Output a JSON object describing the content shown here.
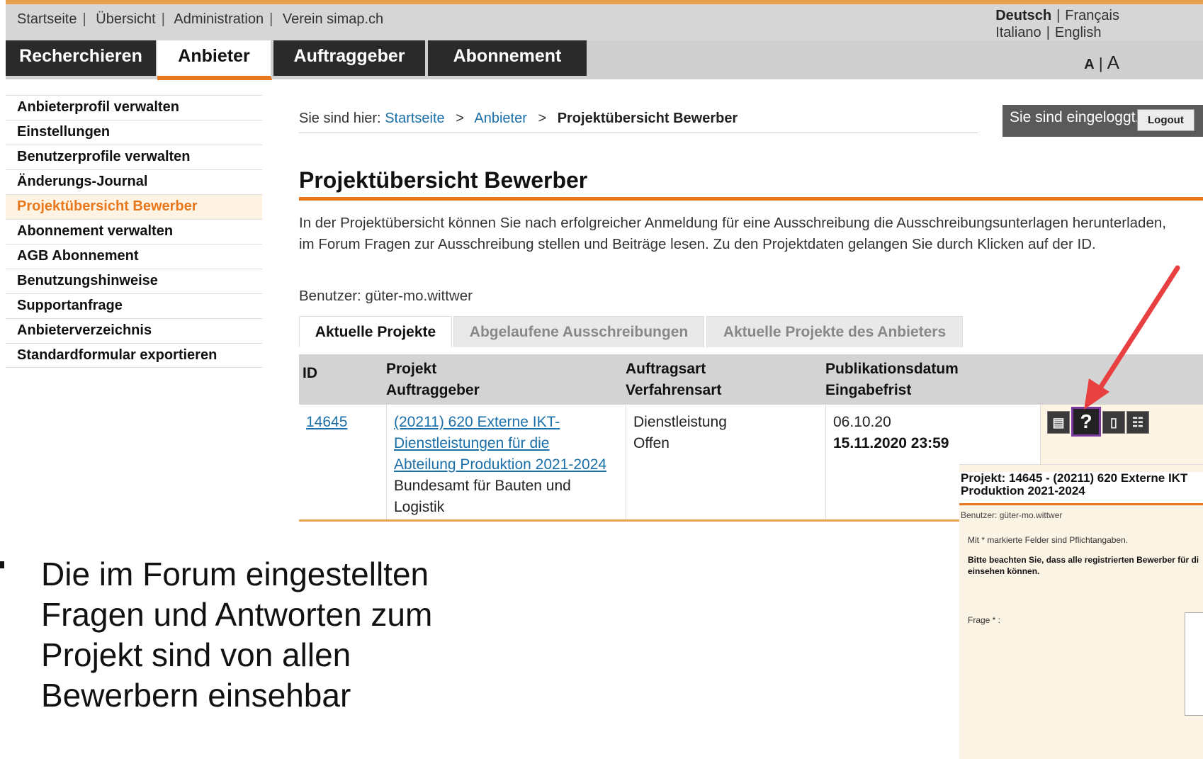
{
  "top_links": [
    "Startseite",
    "Übersicht",
    "Administration",
    "Verein simap.ch"
  ],
  "languages": {
    "line1_active": "Deutsch",
    "line1_other": "Français",
    "line2_a": "Italiano",
    "line2_b": "English"
  },
  "nav": {
    "tabs": [
      "Recherchieren",
      "Anbieter",
      "Auftraggeber",
      "Abonnement"
    ],
    "active": "Anbieter"
  },
  "font_size": {
    "small": "A",
    "sep": "|",
    "big": "A"
  },
  "sidebar": {
    "items": [
      "Anbieterprofil verwalten",
      "Einstellungen",
      "Benutzerprofile verwalten",
      "Änderungs-Journal",
      "Projektübersicht Bewerber",
      "Abonnement verwalten",
      "AGB Abonnement",
      "Benutzungshinweise",
      "Supportanfrage",
      "Anbieterverzeichnis",
      "Standardformular exportieren"
    ],
    "active": "Projektübersicht Bewerber"
  },
  "breadcrumb": {
    "prefix": "Sie sind hier:",
    "items": [
      "Startseite",
      "Anbieter"
    ],
    "current": "Projektübersicht Bewerber",
    "sep": ">"
  },
  "login": {
    "status": "Sie sind eingeloggt.",
    "logout": "Logout"
  },
  "page": {
    "title": "Projektübersicht Bewerber",
    "intro": "In der Projektübersicht können Sie nach erfolgreicher Anmeldung für eine Ausschreibung die Ausschreibungsunterlagen herunterladen, im Forum Fragen zur Ausschreibung stellen und Beiträge lesen. Zu den Projektdaten gelangen Sie durch Klicken auf der ID.",
    "user": "Benutzer: güter-mo.wittwer"
  },
  "tabs": [
    "Aktuelle Projekte",
    "Abgelaufene Ausschreibungen",
    "Aktuelle Projekte des Anbieters"
  ],
  "table": {
    "headers": {
      "id": "ID",
      "projekt": "Projekt",
      "auftraggeber": "Auftraggeber",
      "auftragsart": "Auftragsart",
      "verfahrensart": "Verfahrensart",
      "publikationsdatum": "Publikationsdatum",
      "eingabefrist": "Eingabefrist"
    },
    "rows": [
      {
        "id": "14645",
        "projekt_l1": "(20211) 620 Externe IKT-",
        "projekt_l2": "Dienstleistungen für die",
        "projekt_l3": "Abteilung Produktion 2021-2024",
        "auftraggeber_l1": "Bundesamt für Bauten und",
        "auftraggeber_l2": "Logistik",
        "auftragsart": "Dienstleistung",
        "verfahrensart": "Offen",
        "publikationsdatum": "06.10.20",
        "eingabefrist": "15.11.2020 23:59"
      }
    ]
  },
  "row_icons": [
    "book-icon",
    "question-icon",
    "trash-icon",
    "sitemap-icon"
  ],
  "slide": {
    "bullet_l1": "Die im Forum eingestellten",
    "bullet_l2": "Fragen und Antworten zum",
    "bullet_l3": "Projekt sind von allen",
    "bullet_l4": "Bewerbern einsehbar"
  },
  "popup": {
    "title_l1": "Projekt: 14645 - (20211) 620 Externe IKT",
    "title_l2": "Produktion 2021-2024",
    "user": "Benutzer: güter-mo.wittwer",
    "note1": "Mit * markierte Felder sind Pflichtangaben.",
    "note2_l1": "Bitte beachten Sie, dass alle registrierten Bewerber für di",
    "note2_l2": "einsehen können.",
    "label": "Frage * :"
  },
  "colors": {
    "accent": "#e8781e",
    "link": "#1a6fa8",
    "arrow": "#e84040",
    "highlight_box": "#7a3aa0"
  }
}
